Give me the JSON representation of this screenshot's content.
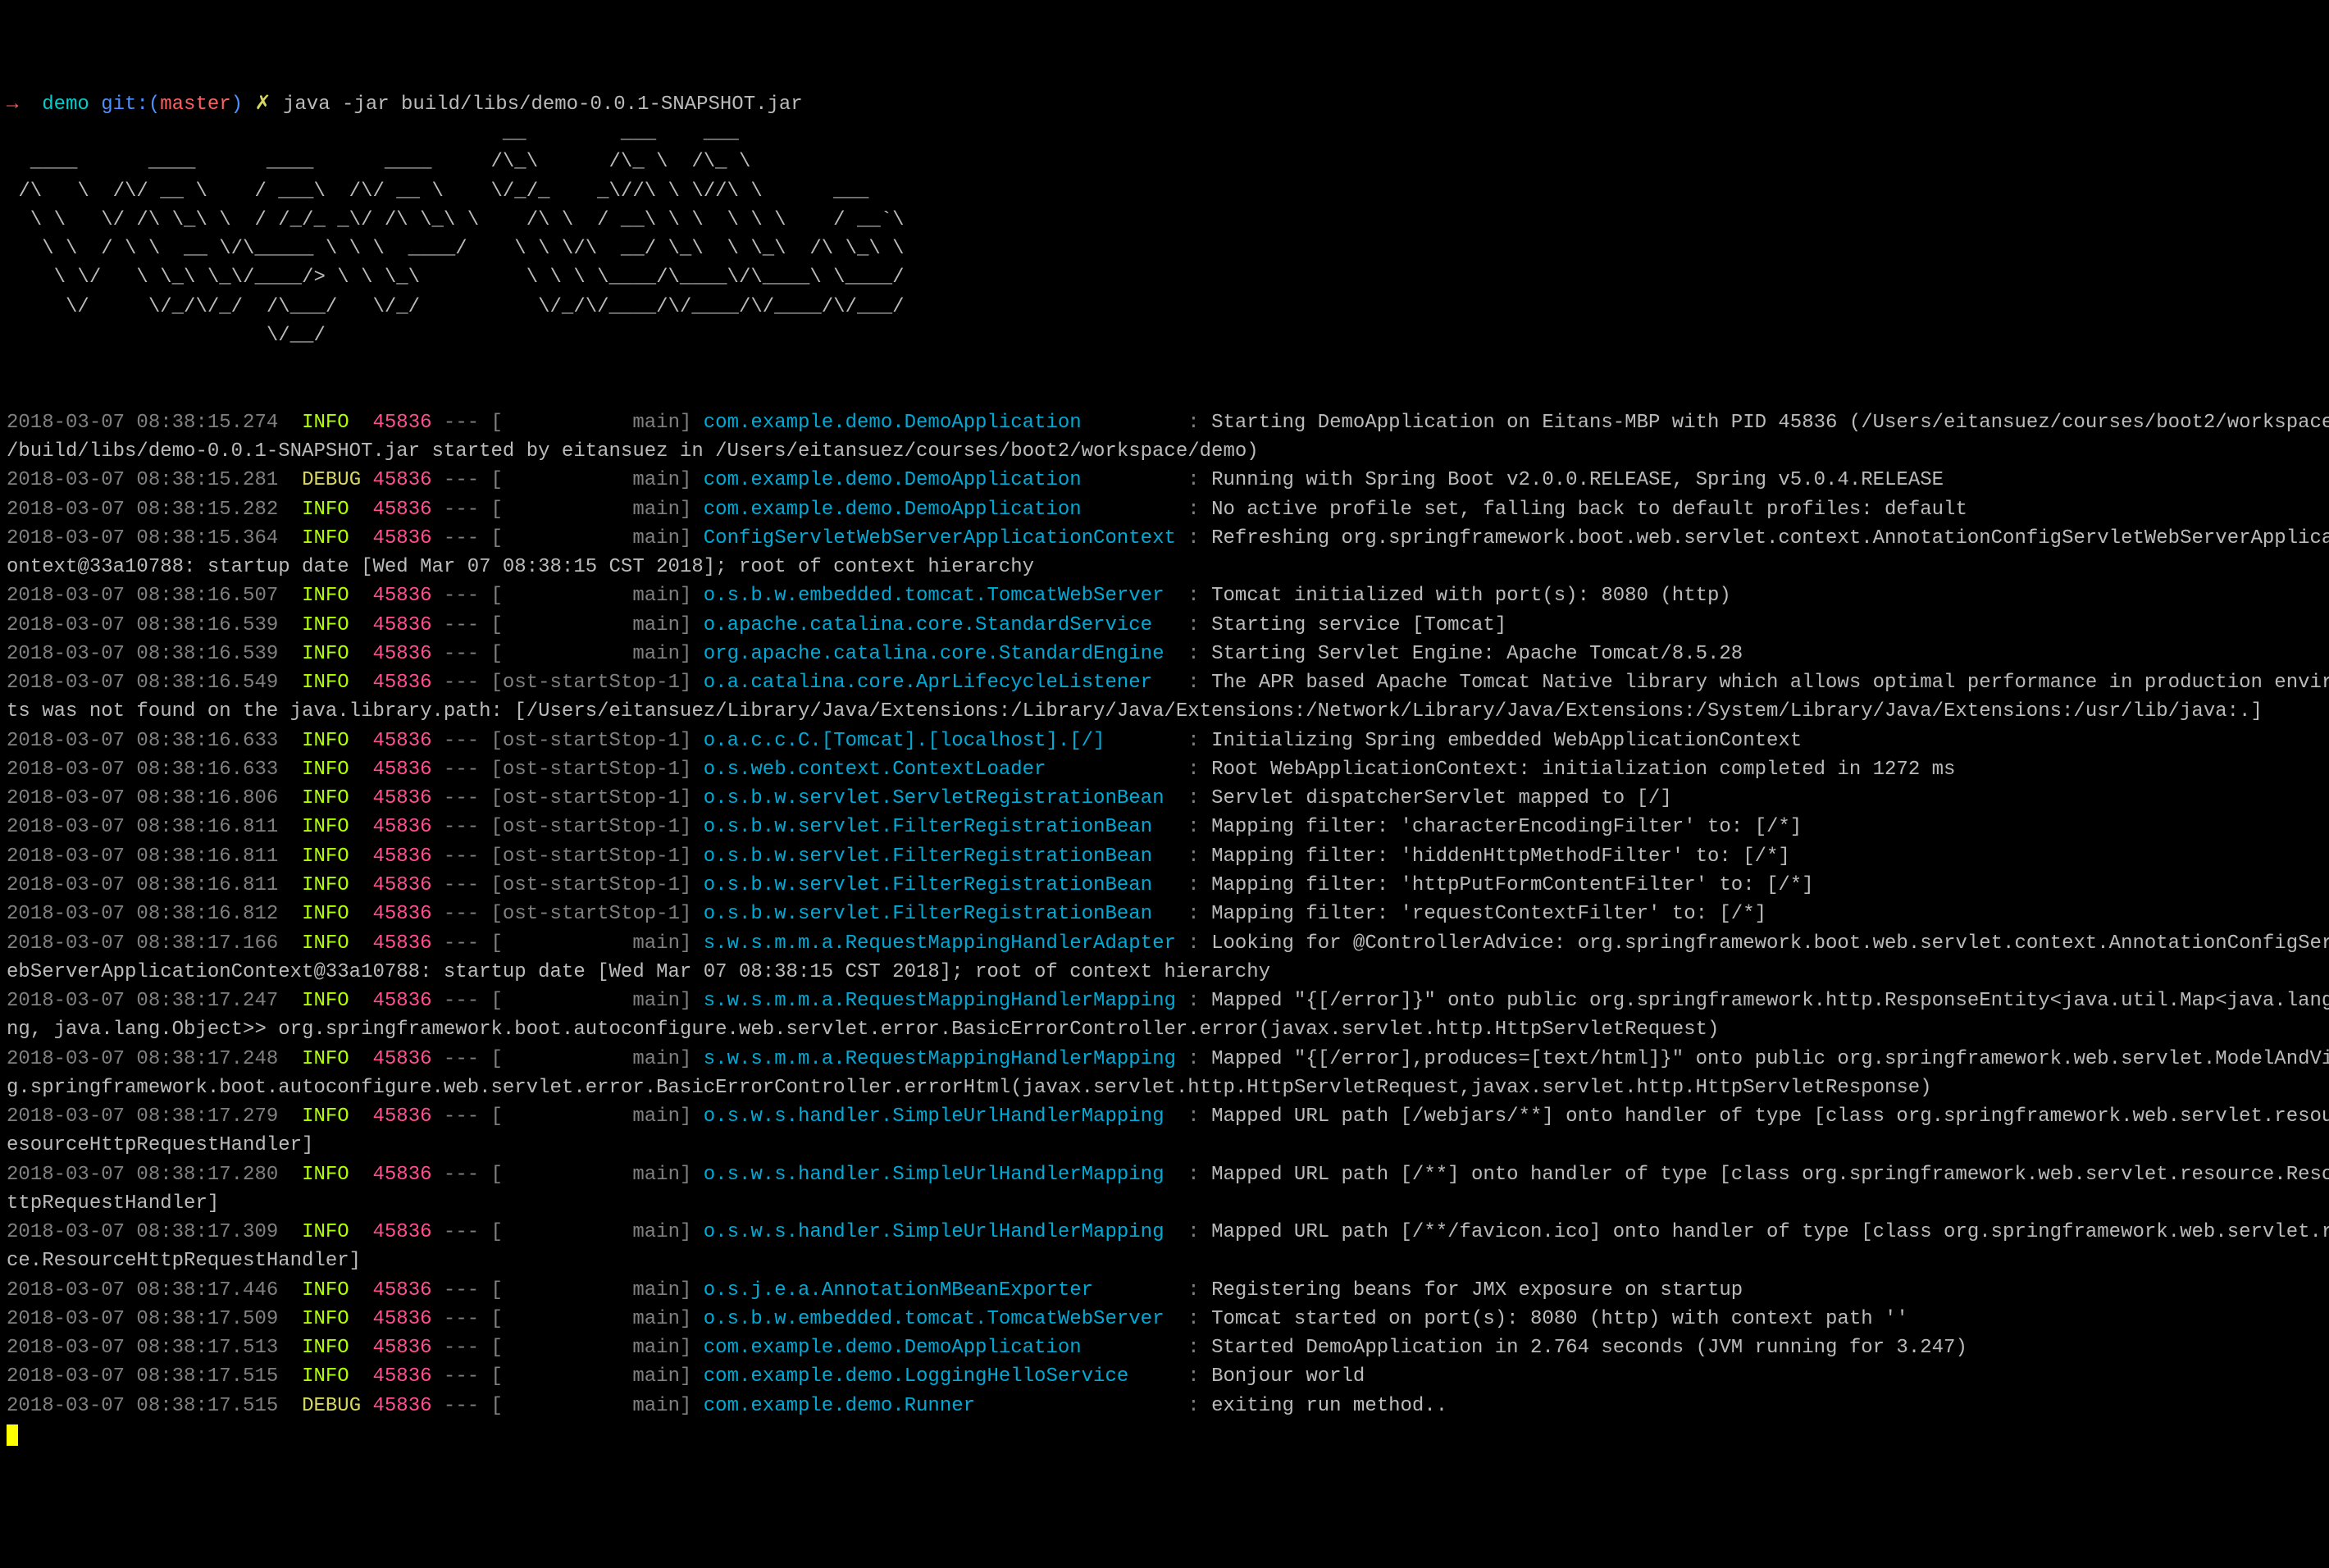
{
  "prompt": {
    "arrow": "→",
    "dir": "demo",
    "git_label": "git:(",
    "branch": "master",
    "git_close": ")",
    "x": "✗",
    "command": "java -jar build/libs/demo-0.0.1-SNAPSHOT.jar"
  },
  "ascii": [
    "                                          __        ___    ___",
    "  ____      ____      ____      ____     /\\_\\      /\\_ \\  /\\_ \\",
    " /\\   \\  /\\/ __ \\    / ___\\  /\\/ __ \\    \\/_/_    _\\//\\ \\ \\//\\ \\      ___",
    "  \\ \\   \\/ /\\ \\_\\ \\  / /_/_ _\\/ /\\ \\_\\ \\    /\\ \\  / __\\ \\ \\  \\ \\ \\    / __`\\",
    "   \\ \\  / \\ \\  __ \\/\\_____ \\ \\ \\  ____/    \\ \\ \\/\\  __/ \\_\\  \\ \\_\\  /\\ \\_\\ \\",
    "    \\ \\/   \\ \\_\\ \\_\\/____/> \\ \\ \\_\\         \\ \\ \\ \\____/\\____\\/\\____\\ \\____/",
    "     \\/     \\/_/\\/_/  /\\___/   \\/_/          \\/_/\\/____/\\/____/\\/____/\\/___/",
    "                      \\/__/"
  ],
  "logs": [
    {
      "ts": "2018-03-07 08:38:15.274",
      "lvl": "INFO",
      "pid": "45836",
      "thread": "[           main]",
      "logger": "com.example.demo.DemoApplication        ",
      "msg": "Starting DemoApplication on Eitans-MBP with PID 45836 (/Users/eitansuez/courses/boot2/workspace/demo"
    },
    {
      "cont": "/build/libs/demo-0.0.1-SNAPSHOT.jar started by eitansuez in /Users/eitansuez/courses/boot2/workspace/demo)"
    },
    {
      "ts": "2018-03-07 08:38:15.281",
      "lvl": "DEBUG",
      "pid": "45836",
      "thread": "[           main]",
      "logger": "com.example.demo.DemoApplication        ",
      "msg": "Running with Spring Boot v2.0.0.RELEASE, Spring v5.0.4.RELEASE"
    },
    {
      "ts": "2018-03-07 08:38:15.282",
      "lvl": "INFO",
      "pid": "45836",
      "thread": "[           main]",
      "logger": "com.example.demo.DemoApplication        ",
      "msg": "No active profile set, falling back to default profiles: default"
    },
    {
      "ts": "2018-03-07 08:38:15.364",
      "lvl": "INFO",
      "pid": "45836",
      "thread": "[           main]",
      "logger": "ConfigServletWebServerApplicationContext",
      "msg": "Refreshing org.springframework.boot.web.servlet.context.AnnotationConfigServletWebServerApplicationC"
    },
    {
      "cont": "ontext@33a10788: startup date [Wed Mar 07 08:38:15 CST 2018]; root of context hierarchy"
    },
    {
      "ts": "2018-03-07 08:38:16.507",
      "lvl": "INFO",
      "pid": "45836",
      "thread": "[           main]",
      "logger": "o.s.b.w.embedded.tomcat.TomcatWebServer ",
      "msg": "Tomcat initialized with port(s): 8080 (http)"
    },
    {
      "ts": "2018-03-07 08:38:16.539",
      "lvl": "INFO",
      "pid": "45836",
      "thread": "[           main]",
      "logger": "o.apache.catalina.core.StandardService  ",
      "msg": "Starting service [Tomcat]"
    },
    {
      "ts": "2018-03-07 08:38:16.539",
      "lvl": "INFO",
      "pid": "45836",
      "thread": "[           main]",
      "logger": "org.apache.catalina.core.StandardEngine ",
      "msg": "Starting Servlet Engine: Apache Tomcat/8.5.28"
    },
    {
      "ts": "2018-03-07 08:38:16.549",
      "lvl": "INFO",
      "pid": "45836",
      "thread": "[ost-startStop-1]",
      "logger": "o.a.catalina.core.AprLifecycleListener  ",
      "msg": "The APR based Apache Tomcat Native library which allows optimal performance in production environmen"
    },
    {
      "cont": "ts was not found on the java.library.path: [/Users/eitansuez/Library/Java/Extensions:/Library/Java/Extensions:/Network/Library/Java/Extensions:/System/Library/Java/Extensions:/usr/lib/java:.]"
    },
    {
      "ts": "2018-03-07 08:38:16.633",
      "lvl": "INFO",
      "pid": "45836",
      "thread": "[ost-startStop-1]",
      "logger": "o.a.c.c.C.[Tomcat].[localhost].[/]      ",
      "msg": "Initializing Spring embedded WebApplicationContext"
    },
    {
      "ts": "2018-03-07 08:38:16.633",
      "lvl": "INFO",
      "pid": "45836",
      "thread": "[ost-startStop-1]",
      "logger": "o.s.web.context.ContextLoader           ",
      "msg": "Root WebApplicationContext: initialization completed in 1272 ms"
    },
    {
      "ts": "2018-03-07 08:38:16.806",
      "lvl": "INFO",
      "pid": "45836",
      "thread": "[ost-startStop-1]",
      "logger": "o.s.b.w.servlet.ServletRegistrationBean ",
      "msg": "Servlet dispatcherServlet mapped to [/]"
    },
    {
      "ts": "2018-03-07 08:38:16.811",
      "lvl": "INFO",
      "pid": "45836",
      "thread": "[ost-startStop-1]",
      "logger": "o.s.b.w.servlet.FilterRegistrationBean  ",
      "msg": "Mapping filter: 'characterEncodingFilter' to: [/*]"
    },
    {
      "ts": "2018-03-07 08:38:16.811",
      "lvl": "INFO",
      "pid": "45836",
      "thread": "[ost-startStop-1]",
      "logger": "o.s.b.w.servlet.FilterRegistrationBean  ",
      "msg": "Mapping filter: 'hiddenHttpMethodFilter' to: [/*]"
    },
    {
      "ts": "2018-03-07 08:38:16.811",
      "lvl": "INFO",
      "pid": "45836",
      "thread": "[ost-startStop-1]",
      "logger": "o.s.b.w.servlet.FilterRegistrationBean  ",
      "msg": "Mapping filter: 'httpPutFormContentFilter' to: [/*]"
    },
    {
      "ts": "2018-03-07 08:38:16.812",
      "lvl": "INFO",
      "pid": "45836",
      "thread": "[ost-startStop-1]",
      "logger": "o.s.b.w.servlet.FilterRegistrationBean  ",
      "msg": "Mapping filter: 'requestContextFilter' to: [/*]"
    },
    {
      "ts": "2018-03-07 08:38:17.166",
      "lvl": "INFO",
      "pid": "45836",
      "thread": "[           main]",
      "logger": "s.w.s.m.m.a.RequestMappingHandlerAdapter",
      "msg": "Looking for @ControllerAdvice: org.springframework.boot.web.servlet.context.AnnotationConfigServletW"
    },
    {
      "cont": "ebServerApplicationContext@33a10788: startup date [Wed Mar 07 08:38:15 CST 2018]; root of context hierarchy"
    },
    {
      "ts": "2018-03-07 08:38:17.247",
      "lvl": "INFO",
      "pid": "45836",
      "thread": "[           main]",
      "logger": "s.w.s.m.m.a.RequestMappingHandlerMapping",
      "msg": "Mapped \"{[/error]}\" onto public org.springframework.http.ResponseEntity<java.util.Map<java.lang.Stri"
    },
    {
      "cont": "ng, java.lang.Object>> org.springframework.boot.autoconfigure.web.servlet.error.BasicErrorController.error(javax.servlet.http.HttpServletRequest)"
    },
    {
      "ts": "2018-03-07 08:38:17.248",
      "lvl": "INFO",
      "pid": "45836",
      "thread": "[           main]",
      "logger": "s.w.s.m.m.a.RequestMappingHandlerMapping",
      "msg": "Mapped \"{[/error],produces=[text/html]}\" onto public org.springframework.web.servlet.ModelAndView or"
    },
    {
      "cont": "g.springframework.boot.autoconfigure.web.servlet.error.BasicErrorController.errorHtml(javax.servlet.http.HttpServletRequest,javax.servlet.http.HttpServletResponse)"
    },
    {
      "ts": "2018-03-07 08:38:17.279",
      "lvl": "INFO",
      "pid": "45836",
      "thread": "[           main]",
      "logger": "o.s.w.s.handler.SimpleUrlHandlerMapping ",
      "msg": "Mapped URL path [/webjars/**] onto handler of type [class org.springframework.web.servlet.resource.R"
    },
    {
      "cont": "esourceHttpRequestHandler]"
    },
    {
      "ts": "2018-03-07 08:38:17.280",
      "lvl": "INFO",
      "pid": "45836",
      "thread": "[           main]",
      "logger": "o.s.w.s.handler.SimpleUrlHandlerMapping ",
      "msg": "Mapped URL path [/**] onto handler of type [class org.springframework.web.servlet.resource.ResourceH"
    },
    {
      "cont": "ttpRequestHandler]"
    },
    {
      "ts": "2018-03-07 08:38:17.309",
      "lvl": "INFO",
      "pid": "45836",
      "thread": "[           main]",
      "logger": "o.s.w.s.handler.SimpleUrlHandlerMapping ",
      "msg": "Mapped URL path [/**/favicon.ico] onto handler of type [class org.springframework.web.servlet.resour"
    },
    {
      "cont": "ce.ResourceHttpRequestHandler]"
    },
    {
      "ts": "2018-03-07 08:38:17.446",
      "lvl": "INFO",
      "pid": "45836",
      "thread": "[           main]",
      "logger": "o.s.j.e.a.AnnotationMBeanExporter       ",
      "msg": "Registering beans for JMX exposure on startup"
    },
    {
      "ts": "2018-03-07 08:38:17.509",
      "lvl": "INFO",
      "pid": "45836",
      "thread": "[           main]",
      "logger": "o.s.b.w.embedded.tomcat.TomcatWebServer ",
      "msg": "Tomcat started on port(s): 8080 (http) with context path ''"
    },
    {
      "ts": "2018-03-07 08:38:17.513",
      "lvl": "INFO",
      "pid": "45836",
      "thread": "[           main]",
      "logger": "com.example.demo.DemoApplication        ",
      "msg": "Started DemoApplication in 2.764 seconds (JVM running for 3.247)"
    },
    {
      "ts": "2018-03-07 08:38:17.515",
      "lvl": "INFO",
      "pid": "45836",
      "thread": "[           main]",
      "logger": "com.example.demo.LoggingHelloService    ",
      "msg": "Bonjour world"
    },
    {
      "ts": "2018-03-07 08:38:17.515",
      "lvl": "DEBUG",
      "pid": "45836",
      "thread": "[           main]",
      "logger": "com.example.demo.Runner                 ",
      "msg": "exiting run method.."
    }
  ]
}
